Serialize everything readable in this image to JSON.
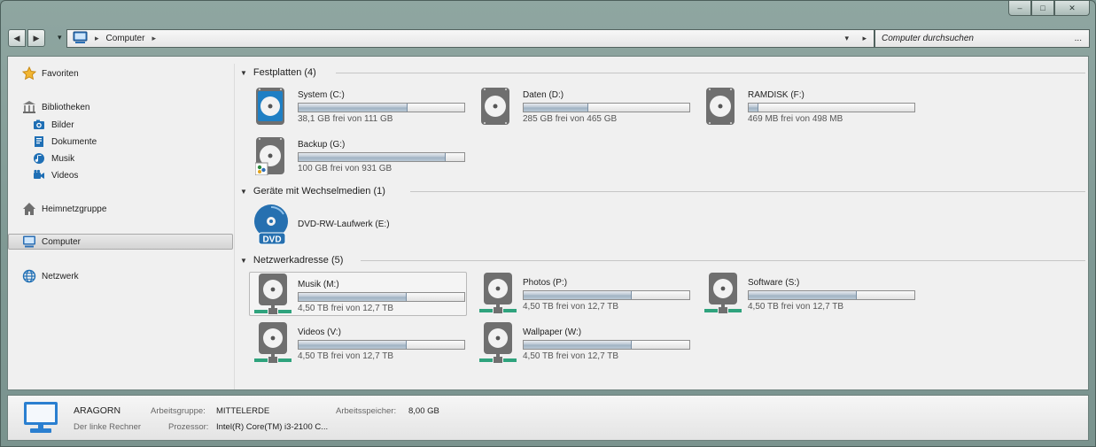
{
  "window": {
    "caption_buttons": {
      "minimize": "–",
      "maximize": "□",
      "close": "✕"
    }
  },
  "toolbar": {
    "back": "◀",
    "forward": "▶",
    "history_dropdown": "▾",
    "breadcrumb": [
      "Computer"
    ],
    "breadcrumb_sep": "▸",
    "address_dropdown": "▾",
    "refresh": "▸",
    "search_placeholder": "Computer durchsuchen",
    "search_more": "..."
  },
  "nav": {
    "favorites": "Favoriten",
    "libraries": "Bibliotheken",
    "library_items": [
      "Bilder",
      "Dokumente",
      "Musik",
      "Videos"
    ],
    "homegroup": "Heimnetzgruppe",
    "computer": "Computer",
    "network": "Netzwerk"
  },
  "groups": [
    {
      "title": "Festplatten (4)",
      "drives": [
        {
          "name": "System (C:)",
          "free": "38,1 GB frei von 111 GB",
          "used_fraction": 0.66,
          "icon": "system-drive-icon"
        },
        {
          "name": "Daten (D:)",
          "free": "285 GB frei von 465 GB",
          "used_fraction": 0.39,
          "icon": "hard-drive-icon"
        },
        {
          "name": "RAMDISK (F:)",
          "free": "469 MB frei von 498 MB",
          "used_fraction": 0.06,
          "icon": "hard-drive-icon"
        },
        {
          "name": "Backup (G:)",
          "free": "100 GB frei von 931 GB",
          "used_fraction": 0.89,
          "icon": "hard-drive-shared-icon"
        }
      ]
    },
    {
      "title": "Geräte mit Wechselmedien (1)",
      "drives": [
        {
          "name": "DVD-RW-Laufwerk (E:)",
          "icon": "dvd-drive-icon",
          "icon_label": "DVD"
        }
      ]
    },
    {
      "title": "Netzwerkadresse (5)",
      "drives": [
        {
          "name": "Musik (M:)",
          "free": "4,50 TB frei von 12,7 TB",
          "used_fraction": 0.65,
          "icon": "network-drive-icon"
        },
        {
          "name": "Photos (P:)",
          "free": "4,50 TB frei von 12,7 TB",
          "used_fraction": 0.65,
          "icon": "network-drive-icon"
        },
        {
          "name": "Software (S:)",
          "free": "4,50 TB frei von 12,7 TB",
          "used_fraction": 0.65,
          "icon": "network-drive-icon"
        },
        {
          "name": "Videos (V:)",
          "free": "4,50 TB frei von 12,7 TB",
          "used_fraction": 0.65,
          "icon": "network-drive-icon"
        },
        {
          "name": "Wallpaper (W:)",
          "free": "4,50 TB frei von 12,7 TB",
          "used_fraction": 0.65,
          "icon": "network-drive-icon"
        }
      ]
    }
  ],
  "details": {
    "computer_name": "ARAGORN",
    "description": "Der linke Rechner",
    "workgroup_label": "Arbeitsgruppe:",
    "workgroup": "MITTELERDE",
    "memory_label": "Arbeitsspeicher:",
    "memory": "8,00 GB",
    "processor_label": "Prozessor:",
    "processor": "Intel(R) Core(TM) i3-2100 C..."
  },
  "colors": {
    "frame": "#7e9893",
    "drive_icon_gray": "#6f6f6f",
    "system_drive_blue": "#1f7fc4",
    "network_green": "#2fa37d",
    "dvd_blue": "#2670b0"
  }
}
